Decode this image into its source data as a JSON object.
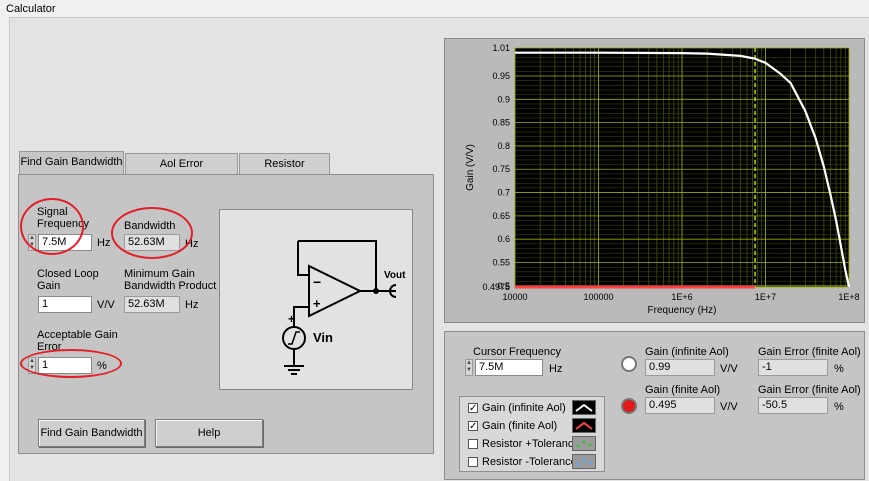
{
  "window": {
    "title": "Calculator"
  },
  "tabs": [
    {
      "label": "Find Gain Bandwidth"
    },
    {
      "label": "Aol Error Considerations"
    },
    {
      "label": "Resistor Tolerance"
    }
  ],
  "left": {
    "signal_frequency": {
      "label_line1": "Signal",
      "label_line2": "Frequency",
      "value": "7.5M",
      "unit": "Hz"
    },
    "bandwidth": {
      "label": "Bandwidth",
      "value": "52.63M",
      "unit": "Hz"
    },
    "closed_loop_gain": {
      "label_line1": "Closed Loop",
      "label_line2": "Gain",
      "value": "1",
      "unit": "V/V"
    },
    "min_gbw": {
      "label_line1": "Minimum Gain",
      "label_line2": "Bandwidth Product",
      "value": "52.63M",
      "unit": "Hz"
    },
    "acceptable_gain_error": {
      "label_line1": "Acceptable Gain",
      "label_line2": "Error",
      "value": "1",
      "unit": "%"
    },
    "schematic": {
      "vout_label": "Vout",
      "vin_label": "Vin",
      "minus": "−",
      "plus": "+"
    },
    "buttons": {
      "find": "Find Gain Bandwidth",
      "help": "Help"
    }
  },
  "chart_data": {
    "type": "line",
    "xlabel": "Frequency (Hz)",
    "ylabel": "Gain (V/V)",
    "x_scale": "log",
    "xlim": [
      10000,
      100000000
    ],
    "ylim": [
      0.4975,
      1.01
    ],
    "x_ticks": [
      "10000",
      "100000",
      "1E+6",
      "1E+7",
      "1E+8"
    ],
    "y_ticks": [
      "1.01",
      "0.95",
      "0.9",
      "0.85",
      "0.8",
      "0.75",
      "0.7",
      "0.65",
      "0.6",
      "0.55",
      "0.5",
      "0.4975"
    ],
    "grid": true,
    "cursor_x": 7500000,
    "series": [
      {
        "name": "Gain (infinite  Aol)",
        "color": "#ffffff",
        "x": [
          10000,
          100000,
          1000000,
          2000000,
          5000000,
          7500000,
          10000000,
          15000000,
          20000000,
          30000000,
          40000000,
          50000000,
          60000000,
          70000000,
          80000000,
          90000000,
          100000000
        ],
        "y": [
          1.0,
          1.0,
          0.999,
          0.998,
          0.993,
          0.987,
          0.978,
          0.955,
          0.935,
          0.875,
          0.815,
          0.755,
          0.695,
          0.64,
          0.585,
          0.535,
          0.4975
        ]
      },
      {
        "name": "Gain (finite Aol)",
        "color": "#ff4040",
        "x": [
          10000,
          7500000
        ],
        "y": [
          0.4975,
          0.4975
        ]
      }
    ]
  },
  "bottom": {
    "cursor_frequency": {
      "label": "Cursor Frequency",
      "value": "7.5M",
      "unit": "Hz"
    },
    "gain_infinite": {
      "label": "Gain (infinite Aol)",
      "value": "0.99",
      "unit": "V/V"
    },
    "gain_error_infinite": {
      "label": "Gain Error (finite Aol)",
      "value": "-1",
      "unit": "%"
    },
    "gain_finite": {
      "label": "Gain (finite Aol)",
      "value": "0.495",
      "unit": "V/V"
    },
    "gain_error_finite": {
      "label": "Gain Error (finite Aol)",
      "value": "-50.5",
      "unit": "%"
    },
    "led_colors": {
      "infinite": "#ffffff",
      "finite": "#e11b1b"
    },
    "legend": [
      {
        "label": "Gain (infinite  Aol)",
        "checked": true,
        "check": "✓",
        "swatch": "white-line"
      },
      {
        "label": "Gain (finite Aol)",
        "checked": true,
        "check": "✓",
        "swatch": "red-line"
      },
      {
        "label": "Resistor +Tolerance",
        "checked": false,
        "check": "",
        "swatch": "green-dots"
      },
      {
        "label": "Resistor -Tolerance",
        "checked": false,
        "check": "",
        "swatch": "blue-dots"
      }
    ]
  }
}
